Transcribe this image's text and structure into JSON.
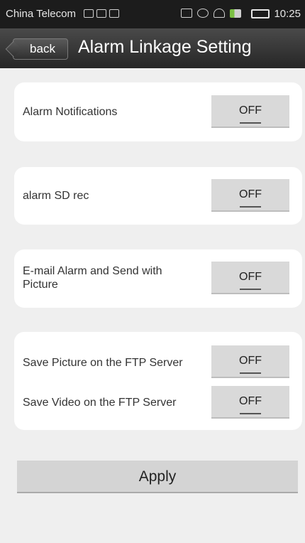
{
  "status_bar": {
    "carrier": "China Telecom",
    "time": "10:25",
    "icons": [
      "usb-icon",
      "image-icon",
      "notification-icon",
      "nfc-icon",
      "alarm-icon",
      "wifi-icon",
      "signal-icon",
      "battery-icon"
    ]
  },
  "header": {
    "back_label": "back",
    "title": "Alarm Linkage Setting"
  },
  "settings": [
    {
      "label": "Alarm Notifications",
      "value": "OFF"
    },
    {
      "label": "alarm SD rec",
      "value": "OFF"
    },
    {
      "label": "E-mail Alarm and Send with Picture",
      "value": "OFF"
    },
    {
      "label": "Save Picture on the FTP Server",
      "value": "OFF"
    },
    {
      "label": "Save Video on the FTP Server",
      "value": "OFF"
    }
  ],
  "apply_label": "Apply"
}
